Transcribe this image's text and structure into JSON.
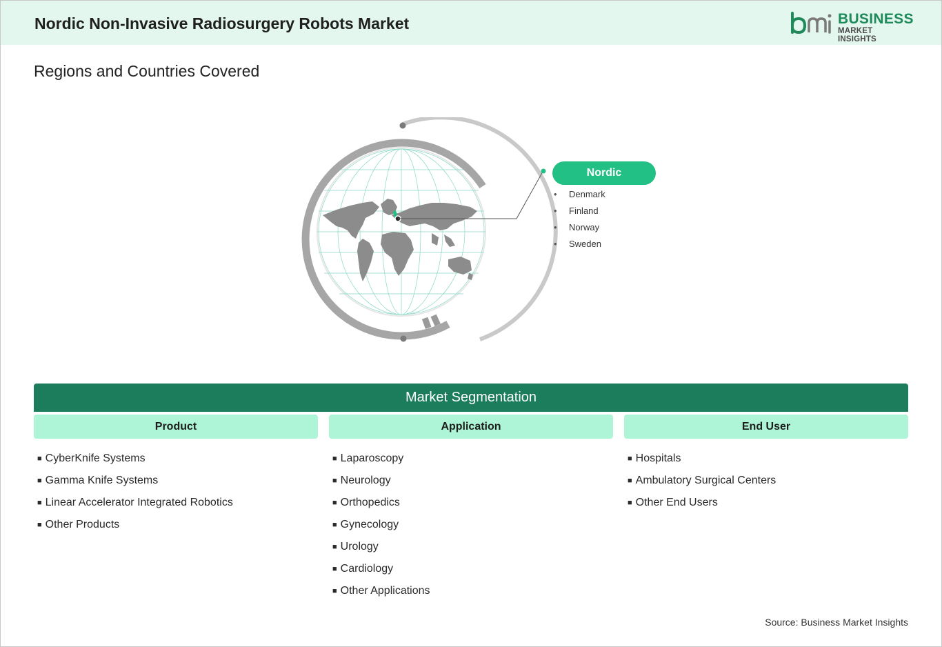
{
  "header": {
    "title": "Nordic Non-Invasive Radiosurgery Robots Market",
    "logo_name": "BUSINESS",
    "logo_sub": "MARKET INSIGHTS",
    "brand_color": "#1e8a5a",
    "header_bg": "#e3f7ee"
  },
  "regions": {
    "section_title": "Regions and Countries Covered",
    "region_label": "Nordic",
    "countries": [
      "Denmark",
      "Finland",
      "Norway",
      "Sweden"
    ],
    "accent": "#22c085",
    "icon": "globe-world-map-icon"
  },
  "segmentation": {
    "title": "Market Segmentation",
    "bar_color": "#1c7d5c",
    "column_bg": "#aef5d7",
    "columns": [
      {
        "heading": "Product",
        "items": [
          "CyberKnife Systems",
          "Gamma Knife Systems",
          "Linear Accelerator Integrated Robotics",
          "Other Products"
        ]
      },
      {
        "heading": "Application",
        "items": [
          "Laparoscopy",
          "Neurology",
          "Orthopedics",
          "Gynecology",
          "Urology",
          "Cardiology",
          "Other Applications"
        ]
      },
      {
        "heading": "End User",
        "items": [
          "Hospitals",
          "Ambulatory Surgical Centers",
          "Other End Users"
        ]
      }
    ]
  },
  "footer": {
    "source": "Source: Business Market Insights"
  }
}
